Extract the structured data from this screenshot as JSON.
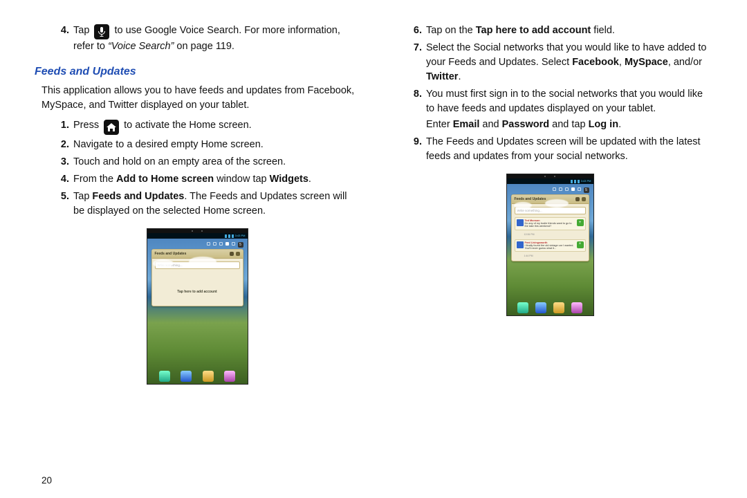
{
  "pageNumber": "20",
  "left": {
    "s4_a": "Tap ",
    "s4_b": " to use Google Voice Search. For more information, refer to ",
    "s4_ref": "“Voice Search”",
    "s4_c": "  on page 119.",
    "heading": "Feeds and Updates",
    "intro": "This application allows you to have feeds and updates from Facebook, MySpace, and Twitter displayed on your tablet.",
    "s1_a": "Press ",
    "s1_b": " to activate the Home screen.",
    "s2": "Navigate to a desired empty Home screen.",
    "s3": "Touch and hold on an empty area of the screen.",
    "l4_a": "From the ",
    "l4_bold1": "Add to Home screen",
    "l4_mid": " window tap ",
    "l4_bold2": "Widgets",
    "l4_end": ".",
    "s5_a": "Tap ",
    "s5_b": "Feeds and Updates",
    "s5_c": ". The Feeds and Updates screen will be displayed on the selected Home screen."
  },
  "right": {
    "s6_a": "Tap on the ",
    "s6_b": "Tap here to add account",
    "s6_c": " field.",
    "s7_a": "Select the Social networks that you would like to have added to your Feeds and Updates. Select ",
    "s7_fb": "Facebook",
    "s7_com": ", ",
    "s7_ms": "MySpace",
    "s7_and": ", and/or ",
    "s7_tw": "Twitter",
    "s7_end": ".",
    "s8_a": "You must first sign in to the social networks that you would like to have feeds and updates displayed on your tablet.",
    "s8_b1": "Enter ",
    "s8_em": "Email",
    "s8_b2": " and ",
    "s8_pw": "Password",
    "s8_b3": " and tap ",
    "s8_li": "Log in",
    "s8_end": ".",
    "s9": "The Feeds and Updates screen will be updated with the latest feeds and updates from your social networks."
  },
  "widget": {
    "title": "Feeds and Updates",
    "placeholder": "Write something...",
    "tapHere": "Tap here to add account",
    "clock": "3:43 PM",
    "feed1_name": "Ted Munson",
    "feed1_text": "Do any of my bodie friends want to go to the lake this weekend?",
    "feed1_time": "12:06 PM",
    "feed2_name": "Fred Livingsworth",
    "feed2_text": "I finally found the old vintage car I wanted. You'll never guess what it...",
    "feed2_time": "1:44 PM"
  },
  "nums": {
    "n1": "1.",
    "n2": "2.",
    "n3": "3.",
    "n4": "4.",
    "n5": "5.",
    "n6": "6.",
    "n7": "7.",
    "n8": "8.",
    "n9": "9."
  }
}
